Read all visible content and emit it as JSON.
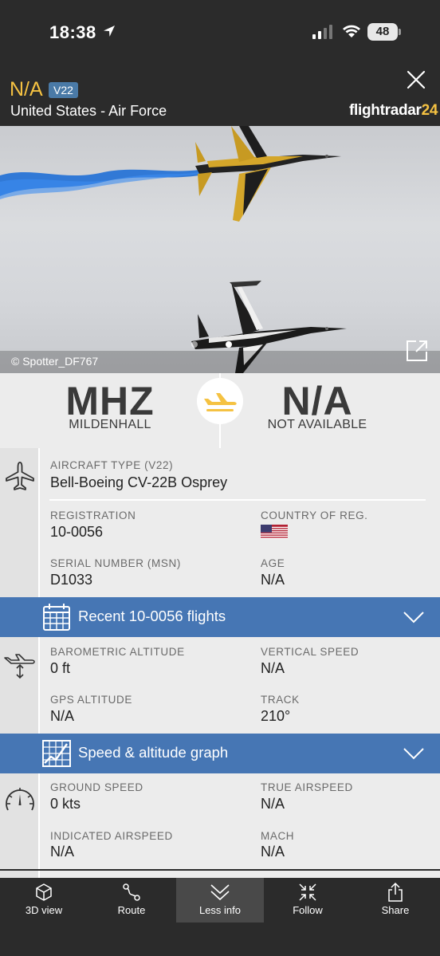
{
  "status_bar": {
    "time": "18:38",
    "battery": "48"
  },
  "header": {
    "callsign": "N/A",
    "aircraft_badge": "V22",
    "operator": "United States - Air Force",
    "brand_text": "flightradar",
    "brand_number": "24"
  },
  "photo": {
    "credit": "© Spotter_DF767"
  },
  "route": {
    "origin_code": "MHZ",
    "origin_name": "MILDENHALL",
    "destination_code": "N/A",
    "destination_name": "NOT AVAILABLE"
  },
  "aircraft": {
    "type_label": "AIRCRAFT TYPE (V22)",
    "type_value": "Bell-Boeing CV-22B Osprey",
    "registration_label": "REGISTRATION",
    "registration_value": "10-0056",
    "country_label": "COUNTRY OF REG.",
    "serial_label": "SERIAL NUMBER (MSN)",
    "serial_value": "D1033",
    "age_label": "AGE",
    "age_value": "N/A"
  },
  "recent_flights_bar": {
    "label": "Recent 10-0056 flights"
  },
  "altitude": {
    "baro_label": "BAROMETRIC ALTITUDE",
    "baro_value": "0 ft",
    "vspeed_label": "VERTICAL SPEED",
    "vspeed_value": "N/A",
    "gps_label": "GPS ALTITUDE",
    "gps_value": "N/A",
    "track_label": "TRACK",
    "track_value": "210°"
  },
  "graph_bar": {
    "label": "Speed & altitude graph"
  },
  "speed": {
    "ground_label": "GROUND SPEED",
    "ground_value": "0 kts",
    "tas_label": "TRUE AIRSPEED",
    "tas_value": "N/A",
    "ias_label": "INDICATED AIRSPEED",
    "ias_value": "N/A",
    "mach_label": "MACH",
    "mach_value": "N/A"
  },
  "tabs": [
    {
      "label": "3D view",
      "icon": "cube-icon"
    },
    {
      "label": "Route",
      "icon": "route-icon"
    },
    {
      "label": "Less info",
      "icon": "chevrons-down-icon",
      "active": true
    },
    {
      "label": "Follow",
      "icon": "follow-icon"
    },
    {
      "label": "Share",
      "icon": "share-icon"
    }
  ],
  "colors": {
    "accent_yellow": "#f5c242",
    "bar_blue": "#4676b4",
    "badge_blue": "#4a7aa7",
    "dark_bg": "#2b2b2b"
  }
}
